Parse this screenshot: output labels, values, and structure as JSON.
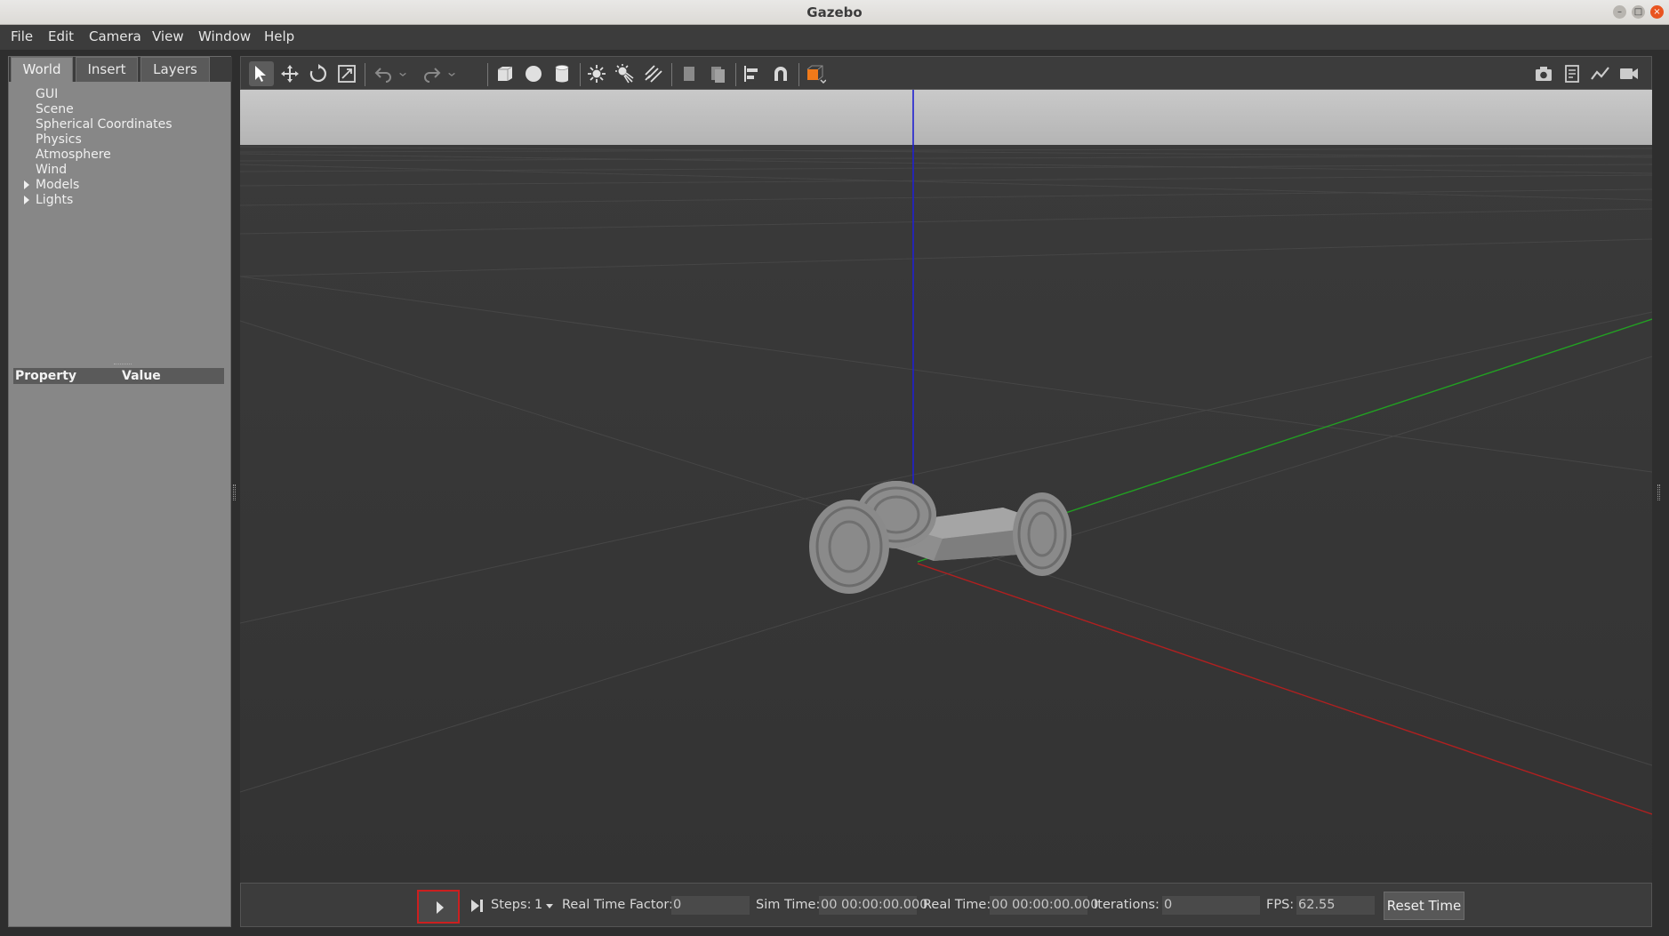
{
  "window": {
    "title": "Gazebo",
    "minimize_icon": "–",
    "maximize_icon": "□",
    "close_icon": "×"
  },
  "menubar": {
    "items": [
      "File",
      "Edit",
      "Camera",
      "View",
      "Window",
      "Help"
    ]
  },
  "left_panel": {
    "tabs": [
      "World",
      "Insert",
      "Layers"
    ],
    "active_tab": "World",
    "tree": [
      {
        "label": "GUI",
        "expandable": false
      },
      {
        "label": "Scene",
        "expandable": false
      },
      {
        "label": "Spherical Coordinates",
        "expandable": false
      },
      {
        "label": "Physics",
        "expandable": false
      },
      {
        "label": "Atmosphere",
        "expandable": false
      },
      {
        "label": "Wind",
        "expandable": false
      },
      {
        "label": "Models",
        "expandable": true
      },
      {
        "label": "Lights",
        "expandable": true
      }
    ],
    "property_header": {
      "property": "Property",
      "value": "Value"
    }
  },
  "toolbar": {
    "tools": [
      {
        "icon": "select-arrow-icon",
        "active": true
      },
      {
        "icon": "translate-icon",
        "active": false
      },
      {
        "icon": "rotate-icon",
        "active": false
      },
      {
        "icon": "scale-icon",
        "active": false
      },
      {
        "icon": "undo-icon",
        "active": false
      },
      {
        "icon": "undo-history-dropdown-icon",
        "active": false
      },
      {
        "icon": "redo-icon",
        "active": false
      },
      {
        "icon": "redo-history-dropdown-icon",
        "active": false
      },
      {
        "icon": "box-shape-icon",
        "active": false
      },
      {
        "icon": "sphere-shape-icon",
        "active": false
      },
      {
        "icon": "cylinder-shape-icon",
        "active": false
      },
      {
        "icon": "point-light-icon",
        "active": false
      },
      {
        "icon": "spot-light-icon",
        "active": false
      },
      {
        "icon": "directional-light-icon",
        "active": false
      },
      {
        "icon": "copy-icon",
        "active": false
      },
      {
        "icon": "paste-icon",
        "active": false
      },
      {
        "icon": "align-icon",
        "active": false
      },
      {
        "icon": "snap-magnet-icon",
        "active": false
      },
      {
        "icon": "view-angle-icon",
        "active": false
      }
    ],
    "right_tools": [
      "screenshot-icon",
      "log-icon",
      "plot-icon",
      "video-record-icon"
    ]
  },
  "colors": {
    "x_axis": "#b02020",
    "y_axis": "#22a022",
    "z_axis": "#2020d0",
    "accent_orange": "#f07a1a",
    "play_highlight": "#cc1f1f"
  },
  "bottombar": {
    "play_icon": "play-icon",
    "step_icon": "step-icon",
    "steps_label": "Steps:",
    "steps_value": "1",
    "rtf_label": "Real Time Factor:",
    "rtf_value": "0",
    "sim_time_label": "Sim Time:",
    "sim_time_value": "00 00:00:00.000",
    "real_time_label": "Real Time:",
    "real_time_value": "00 00:00:00.000",
    "iterations_label": "Iterations:",
    "iterations_value": "0",
    "fps_label": "FPS:",
    "fps_value": "62.55",
    "reset_label": "Reset Time"
  }
}
